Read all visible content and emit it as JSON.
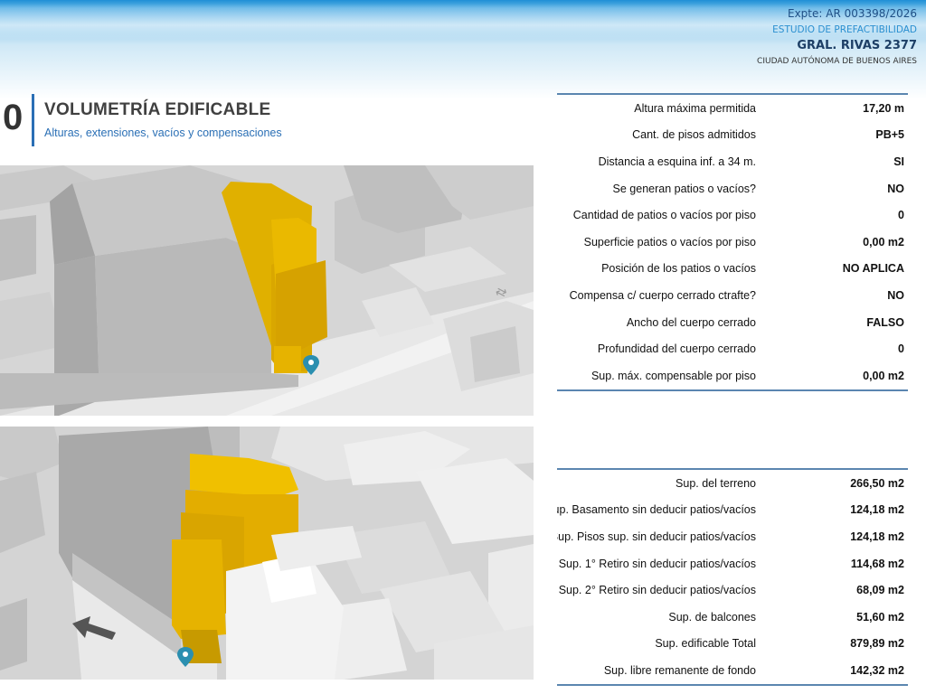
{
  "header": {
    "expte": "Expte: AR 003398/2026",
    "estudio": "ESTUDIO DE PREFACTIBILIDAD",
    "direccion": "GRAL. RIVAS 2377",
    "ciudad": "CIUDAD AUTÓNOMA DE BUENOS AIRES"
  },
  "section": {
    "number": "0",
    "title": "VOLUMETRÍA EDIFICABLE",
    "subtitle": "Alturas, extensiones, vacíos y compensaciones"
  },
  "colors": {
    "accent_blue": "#2a6fb5",
    "volume_yellow": "#e6b300",
    "pin_teal": "#2b8fb0"
  },
  "table_top": [
    {
      "label": "Altura máxima permitida",
      "value": "17,20 m"
    },
    {
      "label": "Cant. de pisos admitidos",
      "value": "PB+5"
    },
    {
      "label": "Distancia a esquina inf. a 34 m.",
      "value": "SI"
    },
    {
      "label": "Se generan patios o vacíos?",
      "value": "NO"
    },
    {
      "label": "Cantidad de patios o vacíos por piso",
      "value": "0"
    },
    {
      "label": "Superficie patios o vacíos por piso",
      "value": "0,00 m2"
    },
    {
      "label": "Posición de los patios o vacíos",
      "value": "NO APLICA"
    },
    {
      "label": "Compensa c/ cuerpo cerrado ctrafte?",
      "value": "NO"
    },
    {
      "label": "Ancho del  cuerpo cerrado",
      "value": "FALSO"
    },
    {
      "label": "Profundidad del  cuerpo cerrado",
      "value": "0"
    },
    {
      "label": "Sup. máx. compensable por piso",
      "value": "0,00 m2"
    }
  ],
  "table_bottom": [
    {
      "label": "Sup. del terreno",
      "value": "266,50 m2"
    },
    {
      "label": "Sup. Basamento sin deducir patios/vacíos",
      "value": "124,18 m2"
    },
    {
      "label": "Sup. Pisos sup. sin deducir patios/vacíos",
      "value": "124,18 m2"
    },
    {
      "label": "Sup. 1° Retiro sin deducir patios/vacíos",
      "value": "114,68 m2"
    },
    {
      "label": "Sup. 2° Retiro sin deducir patios/vacíos",
      "value": "68,09 m2"
    },
    {
      "label": "Sup. de balcones",
      "value": "51,60 m2"
    },
    {
      "label": "Sup. edificable Total",
      "value": "879,89 m2"
    },
    {
      "label": "Sup. libre remanente de fondo",
      "value": "142,32 m2"
    }
  ]
}
